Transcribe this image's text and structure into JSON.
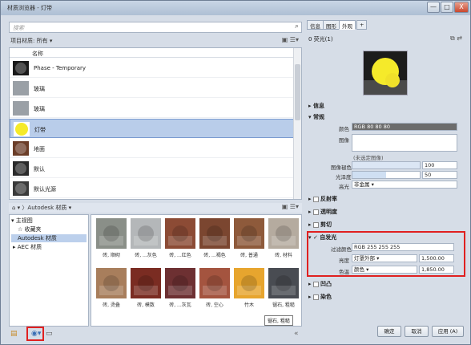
{
  "window": {
    "title": "材质浏览器 - 灯带",
    "buttons": [
      "—",
      "□",
      "X"
    ]
  },
  "browser": {
    "search_placeholder": "搜索",
    "library_filter_label": "项目材质: 所有",
    "list_header": "名称",
    "materials": [
      {
        "name": "Phase - Temporary",
        "swatch": "#1a1a1a"
      },
      {
        "name": "玻璃",
        "swatch": "#9aa0a6"
      },
      {
        "name": "玻璃",
        "swatch": "#9aa0a6"
      },
      {
        "name": "灯带",
        "swatch": "#f5ea2a",
        "selected": true
      },
      {
        "name": "地面",
        "swatch": "#6b3d28"
      },
      {
        "name": "默认",
        "swatch": "#2b2b2b"
      },
      {
        "name": "默认光源",
        "swatch": "#3a3a3a"
      }
    ],
    "breadcrumb": "Autodesk 材质",
    "tree": [
      {
        "label": "▾ 主视图",
        "indent": 0
      },
      {
        "label": "☆ 收藏夹",
        "indent": 8
      },
      {
        "label": "Autodesk 材质",
        "indent": 8,
        "selected": true
      },
      {
        "label": "▸ AEC 材质",
        "indent": 2
      }
    ],
    "tiles": [
      {
        "caption": "砖, 顺砌",
        "color": "#8a8f88"
      },
      {
        "caption": "砖, ...灰色",
        "color": "#b4b7b9"
      },
      {
        "caption": "砖, ...红色",
        "color": "#8c4b35"
      },
      {
        "caption": "砖, ...褐色",
        "color": "#7b4630"
      },
      {
        "caption": "砖, 普通",
        "color": "#8e5a3b"
      },
      {
        "caption": "砖, 材料",
        "color": "#b5ab9f"
      },
      {
        "caption": "砖, 烫叠",
        "color": "#a87e5c"
      },
      {
        "caption": "砖, 模数",
        "color": "#7a2c22"
      },
      {
        "caption": "砖, ...灰瓦",
        "color": "#6d3032"
      },
      {
        "caption": "砖, 空心",
        "color": "#a4543f"
      },
      {
        "caption": "竹木",
        "color": "#e7a52e"
      },
      {
        "caption": "锯石, 粗糙",
        "color": "#494c52"
      }
    ],
    "tooltip": "锯石, 粗糙"
  },
  "editor": {
    "tabs": [
      "信息",
      "图形",
      "外观",
      "+"
    ],
    "material_name": "0 荧光(1)",
    "sections": {
      "info": "信息",
      "generic": "常规",
      "reflectivity": "反射率",
      "transparency": "透明度",
      "cutout": "剪切",
      "self_illumination": "自发光",
      "bump": "凹凸",
      "tint": "染色"
    },
    "props": {
      "color_label": "颜色",
      "color_value": "RGB 80 80 80",
      "image_label": "图像",
      "image_none": "(未选定图像)",
      "image_fade_label": "图像褪色",
      "image_fade_value": "100",
      "glossiness_label": "光泽度",
      "glossiness_value": "50",
      "highlight_label": "高光",
      "highlight_value": "非金属"
    },
    "self_illum": {
      "filter_label": "过滤颜色",
      "filter_value": "RGB 255 255 255",
      "luminance_label": "亮度",
      "luminance_option": "灯罩外部",
      "luminance_value": "1,500.00",
      "temp_label": "色温",
      "temp_option": "颜色",
      "temp_value": "1,850.00"
    }
  },
  "footer": {
    "ok": "确定",
    "cancel": "取消",
    "apply": "应用 (A)"
  },
  "colors": {
    "selection": "#b9cdea",
    "highlight_box": "#e02020",
    "sphere": "#f5ea2a"
  }
}
